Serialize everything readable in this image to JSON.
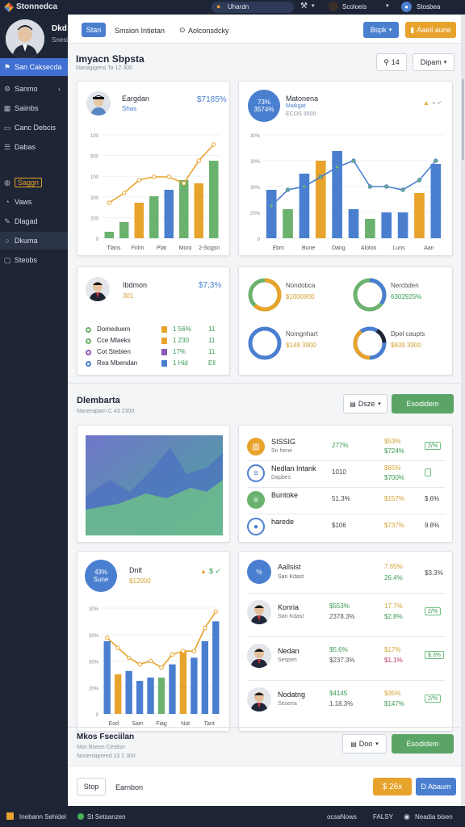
{
  "app": {
    "name": "Stonnedca"
  },
  "topbar": {
    "search_label": "Uhardn",
    "user1": "Scoloeis",
    "user2": "Stosbea"
  },
  "sidebar": {
    "profile_name": "Dkd",
    "profile_sub": "Snesin",
    "items": [
      {
        "label": "San Caksecda",
        "icon": "users-icon",
        "active": true
      },
      {
        "label": "Sanmo",
        "icon": "gear-icon",
        "chevron": true
      },
      {
        "label": "Saiinbs",
        "icon": "grid-icon"
      },
      {
        "label": "Canc Debcis",
        "icon": "chat-icon"
      },
      {
        "label": "Dabas",
        "icon": "list-icon"
      },
      {
        "label": "Saggn",
        "icon": "globe-icon",
        "boxed": true
      },
      {
        "label": "Vaws",
        "icon": "eye-icon"
      },
      {
        "label": "Dlagad",
        "icon": "pen-icon"
      },
      {
        "label": "Dkuma",
        "icon": "circle-icon",
        "highlight": true
      },
      {
        "label": "Steobs",
        "icon": "box-icon"
      }
    ]
  },
  "header": {
    "tab_active": "Stan",
    "tab2": "Smsion Intietan",
    "tab3": "Aolconsdcky",
    "btn_select": "Bspk",
    "btn_orange": "Aaeil aune"
  },
  "section1": {
    "title": "Imyacn Sbpsta",
    "subtitle": "Nanagigens Ta 12 300",
    "btn_count": "14",
    "btn_dropdown": "Dipam"
  },
  "card1": {
    "name": "Eargdan",
    "role": "Shas",
    "value": "$7185%",
    "chart_data": {
      "type": "bar",
      "categories": [
        "Tlans",
        "Fnlm",
        "Plat",
        "Moro",
        "2-Sogsn"
      ],
      "yticks": [
        "100",
        "500",
        "100",
        "200",
        "200",
        "0"
      ],
      "bars": [
        2,
        5,
        11,
        13,
        15,
        18,
        17,
        24
      ],
      "line": [
        11,
        14,
        18,
        19,
        19,
        17,
        24,
        29
      ]
    }
  },
  "card2": {
    "badge": "73% 3574%",
    "name": "Matonena",
    "role": "Maikgat",
    "sub": "ECOS 3500",
    "chart_data": {
      "type": "bar",
      "categories": [
        "Ebm",
        "Bune",
        "Dang",
        "Aloloo",
        "Luns",
        "Aan"
      ],
      "yticks": [
        "30%",
        "30%",
        "30%",
        "20%",
        "0"
      ],
      "bars": [
        15,
        9,
        20,
        24,
        27,
        9,
        6,
        8,
        8,
        14,
        23
      ],
      "line": [
        10,
        15,
        16,
        19,
        22,
        24,
        16,
        16,
        15,
        18,
        24
      ]
    }
  },
  "card3": {
    "name": "Ibdmon",
    "role": "301",
    "value": "$7,3%",
    "rows": [
      {
        "label": "Domeduem",
        "value": "1 56%",
        "extra": "11"
      },
      {
        "label": "Cce Mlaeks",
        "value": "1 230",
        "extra": "11"
      },
      {
        "label": "Cot Stebien",
        "value": "17%",
        "extra": "11"
      },
      {
        "label": "Rea Mbendan",
        "value": "1 Hid",
        "extra": "Ell"
      }
    ]
  },
  "card4": {
    "donuts": [
      {
        "label": "Nondobca",
        "value": "$1000900"
      },
      {
        "label": "Nercbden",
        "value": "6302925%"
      },
      {
        "label": "Nomgnhart",
        "value": "$148 3900"
      },
      {
        "label": "Dpel caupts",
        "value": "$839 3900"
      }
    ]
  },
  "section2": {
    "title": "Dlembarta",
    "subtitle": "Naneraparn C 43 2300",
    "btn_dropdown": "Dsze",
    "btn_green": "Esodidem"
  },
  "card6": {
    "rows": [
      {
        "title": "SISSIG",
        "sub": "Sn hene",
        "v1": "277%",
        "v2a": "$53%",
        "v2b": "$724%",
        "badge": "2/%"
      },
      {
        "title": "Nedlan Intank",
        "sub": "Dapbes",
        "v1": "1010",
        "v2a": "$65%",
        "v2b": "$700%",
        "badge": ""
      },
      {
        "title": "Buntoke",
        "sub": "",
        "v1": "51.3%",
        "v2a": "$157%",
        "v2b": "",
        "badge": "$.6%"
      },
      {
        "title": "harede",
        "sub": "",
        "v1": "$106",
        "v2a": "$737%",
        "v2b": "",
        "badge": "9.8%"
      }
    ]
  },
  "card7": {
    "badge": "43% Sune",
    "name": "Dnlt",
    "sub": "$12000",
    "chart_data": {
      "type": "bar",
      "categories": [
        "Eod",
        "Sam",
        "Fiag",
        "Nat",
        "Tant"
      ],
      "yticks": [
        "30%",
        "30%",
        "30%",
        "20%",
        "0"
      ],
      "bars": [
        22,
        12,
        13,
        10,
        11,
        11,
        15,
        19,
        17,
        22,
        28
      ],
      "line": [
        23,
        20,
        17,
        15,
        16,
        14,
        18,
        19,
        19,
        26,
        31
      ]
    }
  },
  "card8": {
    "header": {
      "title": "Aallsist",
      "sub": "San Kdast",
      "v1": "7.65%",
      "v2": "26.4%",
      "v3": "$3.3%"
    },
    "rows": [
      {
        "name": "Konria",
        "sub": "San Kdast",
        "v1": "$553%",
        "v1b": "2378.3%",
        "v2": "17.7%",
        "v2b": "$2.8%",
        "badge": "2/%"
      },
      {
        "name": "Nedan",
        "sub": "Sespen",
        "v1": "$5.6%",
        "v1b": "$237.3%",
        "v2": "$17%",
        "v2b": "$1.1%",
        "badge": "$.3%"
      },
      {
        "name": "Nodatng",
        "sub": "Seseria",
        "v1": "$4145",
        "v1b": "1.18.3%",
        "v2": "$35%",
        "v2b": "$147%",
        "badge": "2/%"
      }
    ]
  },
  "section3": {
    "title": "Mkos Fseciilan",
    "sub1": "Non Bseon Cestisn",
    "sub2": "Nuseniapreed 13 2 300",
    "btn_dropdown": "Doo",
    "btn_green": "Esodidem"
  },
  "footer": {
    "btn_stop": "Stop",
    "label": "Earnbon",
    "btn_price": "$ 26x",
    "btn_blue": "D Abaum"
  },
  "bottombar": {
    "left": "Inebann Sehidel",
    "status": "St Setsanzen",
    "r1": "ocsaNows",
    "r2": "FALSY",
    "r3": "Neadia bisen"
  },
  "colors": {
    "blue": "#4a7fd0",
    "green": "#6bb26e",
    "orange": "#e8a32c",
    "olive": "#d3a12f",
    "navy": "#1e2535"
  }
}
